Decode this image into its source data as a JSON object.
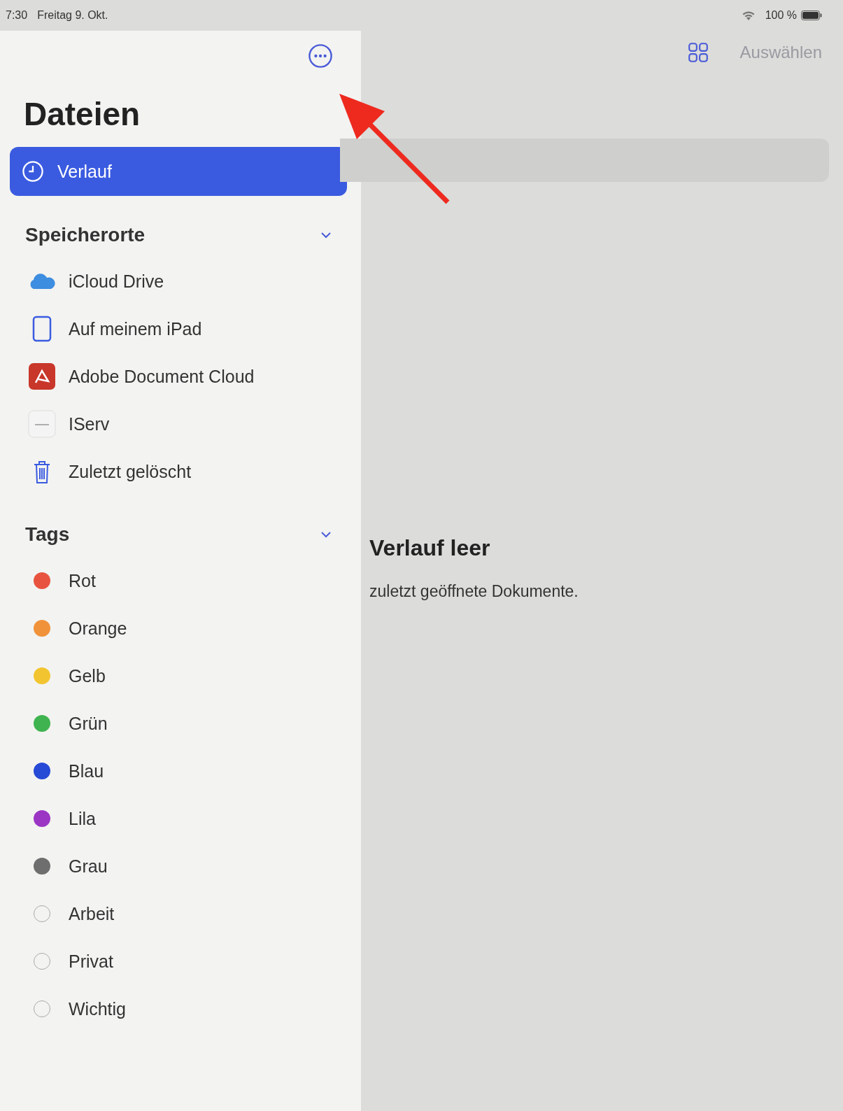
{
  "status_bar": {
    "time": "7:30",
    "date": "Freitag 9. Okt.",
    "battery": "100 %"
  },
  "sidebar": {
    "title": "Dateien",
    "items": [
      {
        "label": "Verlauf",
        "selected": true
      }
    ],
    "sections": [
      {
        "title": "Speicherorte",
        "expanded": true,
        "items": [
          {
            "label": "iCloud Drive",
            "kind": "cloud"
          },
          {
            "label": "Auf meinem iPad",
            "kind": "tablet"
          },
          {
            "label": "Adobe Document Cloud",
            "kind": "pdf"
          },
          {
            "label": "IServ",
            "kind": "server"
          },
          {
            "label": "Zuletzt gelöscht",
            "kind": "trash"
          }
        ]
      },
      {
        "title": "Tags",
        "expanded": true,
        "items": [
          {
            "label": "Rot",
            "kind": "tag",
            "color": "#e8533f"
          },
          {
            "label": "Orange",
            "kind": "tag",
            "color": "#f0923a"
          },
          {
            "label": "Gelb",
            "kind": "tag",
            "color": "#f2c530"
          },
          {
            "label": "Grün",
            "kind": "tag",
            "color": "#3fb34f"
          },
          {
            "label": "Blau",
            "kind": "tag",
            "color": "#2649d6"
          },
          {
            "label": "Lila",
            "kind": "tag",
            "color": "#9b36c4"
          },
          {
            "label": "Grau",
            "kind": "tag",
            "color": "#6e6e6e"
          },
          {
            "label": "Arbeit",
            "kind": "empty-tag"
          },
          {
            "label": "Privat",
            "kind": "empty-tag"
          },
          {
            "label": "Wichtig",
            "kind": "empty-tag"
          }
        ]
      }
    ]
  },
  "toolbar": {
    "select": "Auswählen",
    "select_disabled": true
  },
  "empty_state": {
    "title": "Verlauf leer",
    "message": "zuletzt geöffnete Dokumente."
  }
}
